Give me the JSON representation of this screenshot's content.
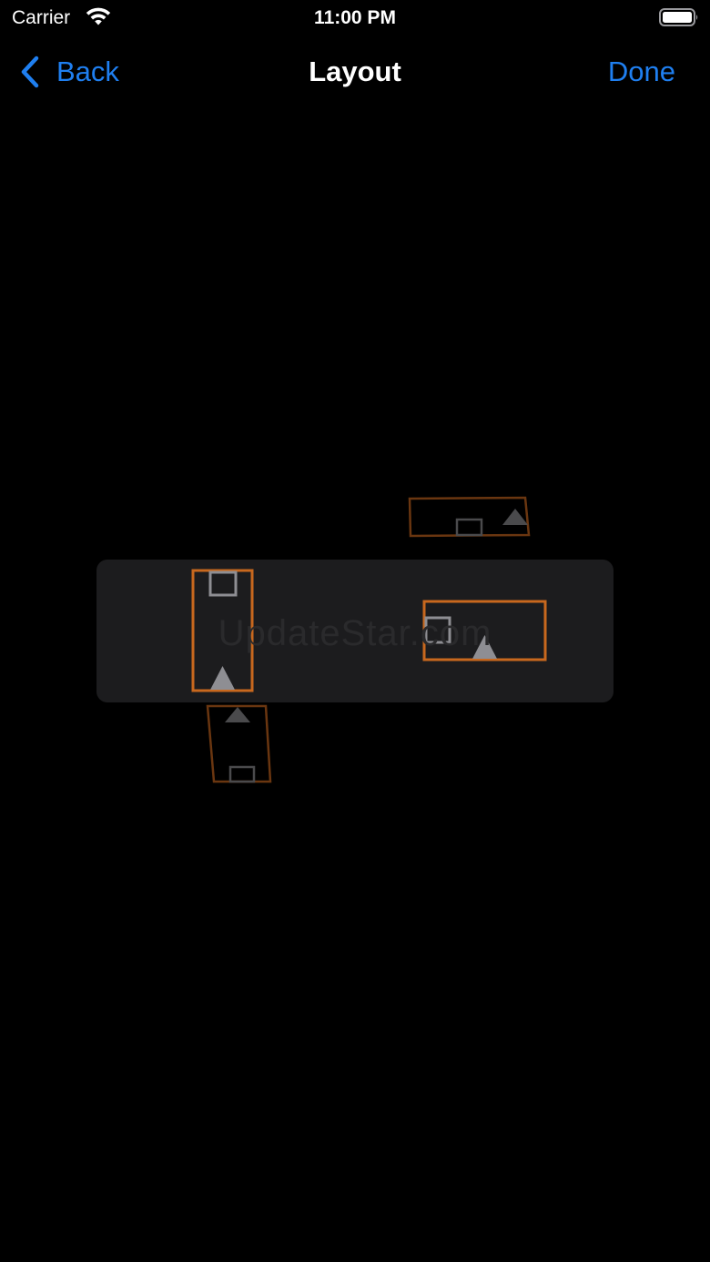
{
  "status_bar": {
    "carrier": "Carrier",
    "time": "11:00 PM"
  },
  "nav_bar": {
    "back_label": "Back",
    "title": "Layout",
    "done_label": "Done"
  },
  "layout": {
    "watermark": "UpdateStar.com"
  },
  "colors": {
    "accent": "#1f7ff0",
    "frame_active": "#c8681e",
    "frame_ghost": "#6a3610",
    "panel": "#1c1c1e",
    "marker_light": "#8e8e93",
    "marker_dim": "#4a4a4c"
  }
}
